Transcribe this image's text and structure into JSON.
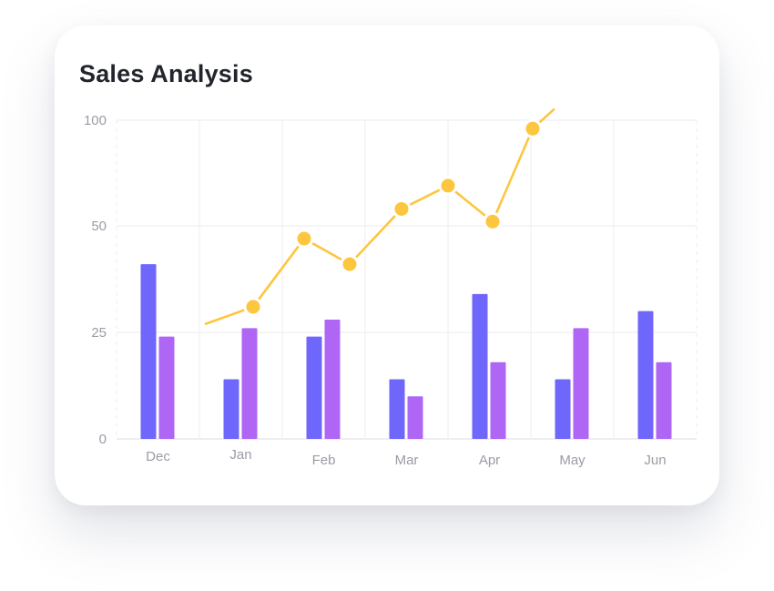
{
  "card": {
    "title": "Sales Analysis"
  },
  "chart_data": {
    "type": "bar",
    "categories": [
      "Dec",
      "Jan",
      "Feb",
      "Mar",
      "Apr",
      "May",
      "Jun"
    ],
    "y_ticks": [
      "0",
      "25",
      "50",
      "100"
    ],
    "series": [
      {
        "type": "bar",
        "color": "#6f66fb",
        "values": [
          41,
          14,
          24,
          14,
          34,
          14,
          30
        ]
      },
      {
        "type": "bar",
        "color": "#b066f5",
        "values": [
          24,
          26,
          28,
          10,
          18,
          26,
          18
        ]
      },
      {
        "type": "line",
        "color": "#fdc63f",
        "values": [
          null,
          31,
          47,
          41,
          58,
          69,
          52,
          96
        ],
        "x": [
          "Jan",
          "Feb",
          "Feb",
          "Mar",
          "Apr",
          "Apr",
          "May",
          "May"
        ]
      }
    ],
    "grid": true
  }
}
